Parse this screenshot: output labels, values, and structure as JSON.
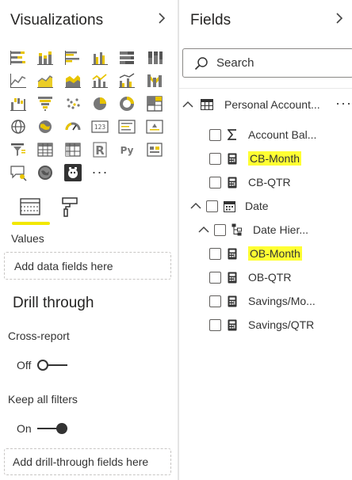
{
  "visualizations": {
    "title": "Visualizations",
    "collapse_icon": "chevron-right-icon",
    "icon_rows": [
      [
        "stacked-bar-chart-icon",
        "stacked-column-chart-icon",
        "clustered-bar-chart-icon",
        "clustered-column-chart-icon",
        "100-stacked-bar-chart-icon",
        "100-stacked-column-chart-icon"
      ],
      [
        "line-chart-icon",
        "area-chart-icon",
        "stacked-area-chart-icon",
        "line-and-column-chart-icon",
        "line-and-clustered-column-chart-icon",
        "ribbon-chart-icon"
      ],
      [
        "waterfall-chart-icon",
        "funnel-chart-icon",
        "scatter-chart-icon",
        "pie-chart-icon",
        "donut-chart-icon",
        "treemap-icon"
      ],
      [
        "map-icon",
        "filled-map-icon",
        "gauge-icon",
        "card-icon",
        "multi-row-card-icon",
        "kpi-icon"
      ],
      [
        "slicer-icon",
        "table-icon",
        "matrix-icon",
        "r-script-visual-icon",
        "python-visual-icon",
        "key-influencers-icon"
      ],
      [
        "qa-visual-icon",
        "arcgis-map-icon",
        "custom-visual-icon",
        "more-visuals-icon"
      ]
    ],
    "card_icon_text": "123",
    "r_icon_text": "R",
    "py_icon_text": "Py",
    "more_text": "···",
    "tabs": {
      "build": "fields-tab-icon",
      "format": "format-paint-roller-icon"
    },
    "values_label": "Values",
    "values_placeholder": "Add data fields here",
    "drill_through_title": "Drill through",
    "cross_report_label": "Cross-report",
    "cross_report_state": "Off",
    "keep_filters_label": "Keep all filters",
    "keep_filters_state": "On",
    "drill_placeholder": "Add drill-through fields here"
  },
  "fields": {
    "title": "Fields",
    "collapse_icon": "chevron-right-icon",
    "search_placeholder": "Search",
    "table_name": "Personal Account...",
    "more_options": "···",
    "items": [
      {
        "label": "Account Bal...",
        "icon": "sigma-icon",
        "highlighted": false
      },
      {
        "label": "CB-Month",
        "icon": "calculator-icon",
        "highlighted": true
      },
      {
        "label": "CB-QTR",
        "icon": "calculator-icon",
        "highlighted": false
      },
      {
        "label": "Date",
        "icon": "calendar-icon",
        "highlighted": false
      },
      {
        "label": "Date Hier...",
        "icon": "hierarchy-icon",
        "highlighted": false
      },
      {
        "label": "OB-Month",
        "icon": "calculator-icon",
        "highlighted": true
      },
      {
        "label": "OB-QTR",
        "icon": "calculator-icon",
        "highlighted": false
      },
      {
        "label": "Savings/Mo...",
        "icon": "calculator-icon",
        "highlighted": false
      },
      {
        "label": "Savings/QTR",
        "icon": "calculator-icon",
        "highlighted": false
      }
    ]
  },
  "colors": {
    "highlight": "#ffff33",
    "viz_yellow": "#e8c400",
    "viz_gray": "#777777",
    "divider": "#e4e4e4"
  }
}
